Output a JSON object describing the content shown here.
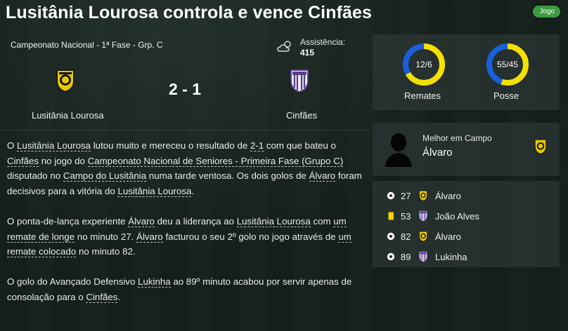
{
  "header": {
    "title": "Lusitânia Lourosa controla e vence Cinfães",
    "badge": "Jogo"
  },
  "match": {
    "competition": "Campeonato Nacional - 1ª Fase - Grp. C",
    "weather_icon": "cloudy-weather-icon",
    "attendance_label": "Assistência:",
    "attendance_value": "415",
    "score": "2 - 1",
    "home_team": "Lusitânia Lourosa",
    "away_team": "Cinfães"
  },
  "report": {
    "p1": [
      {
        "t": "O ",
        "u": false
      },
      {
        "t": "Lusitânia Lourosa",
        "u": true
      },
      {
        "t": " lutou muito e mereceu o resultado de ",
        "u": false
      },
      {
        "t": "2-1",
        "u": true
      },
      {
        "t": " com que bateu o ",
        "u": false
      },
      {
        "t": "Cinfães",
        "u": true
      },
      {
        "t": " no jogo do ",
        "u": false
      },
      {
        "t": "Campeonato Nacional de Seniores - Primeira Fase (Grupo C)",
        "u": true
      },
      {
        "t": " disputado no ",
        "u": false
      },
      {
        "t": "Campo do Lusitânia",
        "u": true
      },
      {
        "t": " numa tarde ventosa. Os dois golos de ",
        "u": false
      },
      {
        "t": "Álvaro",
        "u": true
      },
      {
        "t": " foram decisivos para a vitória do ",
        "u": false
      },
      {
        "t": "Lusitânia Lourosa",
        "u": true
      },
      {
        "t": ".",
        "u": false
      }
    ],
    "p2": [
      {
        "t": "O ponta-de-lança experiente ",
        "u": false
      },
      {
        "t": "Álvaro",
        "u": true
      },
      {
        "t": " deu a liderança ao ",
        "u": false
      },
      {
        "t": "Lusitânia Lourosa",
        "u": true
      },
      {
        "t": " com ",
        "u": false
      },
      {
        "t": "um remate de longe",
        "u": true
      },
      {
        "t": " no minuto 27. ",
        "u": false
      },
      {
        "t": "Álvaro",
        "u": true
      },
      {
        "t": " facturou o seu 2º golo no jogo através de ",
        "u": false
      },
      {
        "t": "um remate colocado",
        "u": true
      },
      {
        "t": " no minuto 82.",
        "u": false
      }
    ],
    "p3": [
      {
        "t": "O golo do Avançado Defensivo ",
        "u": false
      },
      {
        "t": "Lukinha",
        "u": true
      },
      {
        "t": " ao 89º minuto acabou por servir apenas de consolação para o ",
        "u": false
      },
      {
        "t": "Cinfães",
        "u": true
      },
      {
        "t": ".",
        "u": false
      }
    ]
  },
  "stats": {
    "shots": {
      "label": "Remates",
      "value_text": "12/6",
      "home": 12,
      "away": 6
    },
    "possession": {
      "label": "Posse",
      "value_text": "55/45",
      "home": 55,
      "away": 45
    },
    "home_color": "#f5e000",
    "away_color": "#1a5fd8"
  },
  "motm": {
    "label": "Melhor em Campo",
    "name": "Álvaro"
  },
  "events": [
    {
      "icon": "goal-ball-icon",
      "minute": "27",
      "team": "home",
      "player": "Álvaro"
    },
    {
      "icon": "yellow-card-icon",
      "minute": "53",
      "team": "away",
      "player": "João Alves"
    },
    {
      "icon": "goal-ball-icon",
      "minute": "82",
      "team": "home",
      "player": "Álvaro"
    },
    {
      "icon": "goal-ball-icon",
      "minute": "89",
      "team": "away",
      "player": "Lukinha"
    }
  ]
}
